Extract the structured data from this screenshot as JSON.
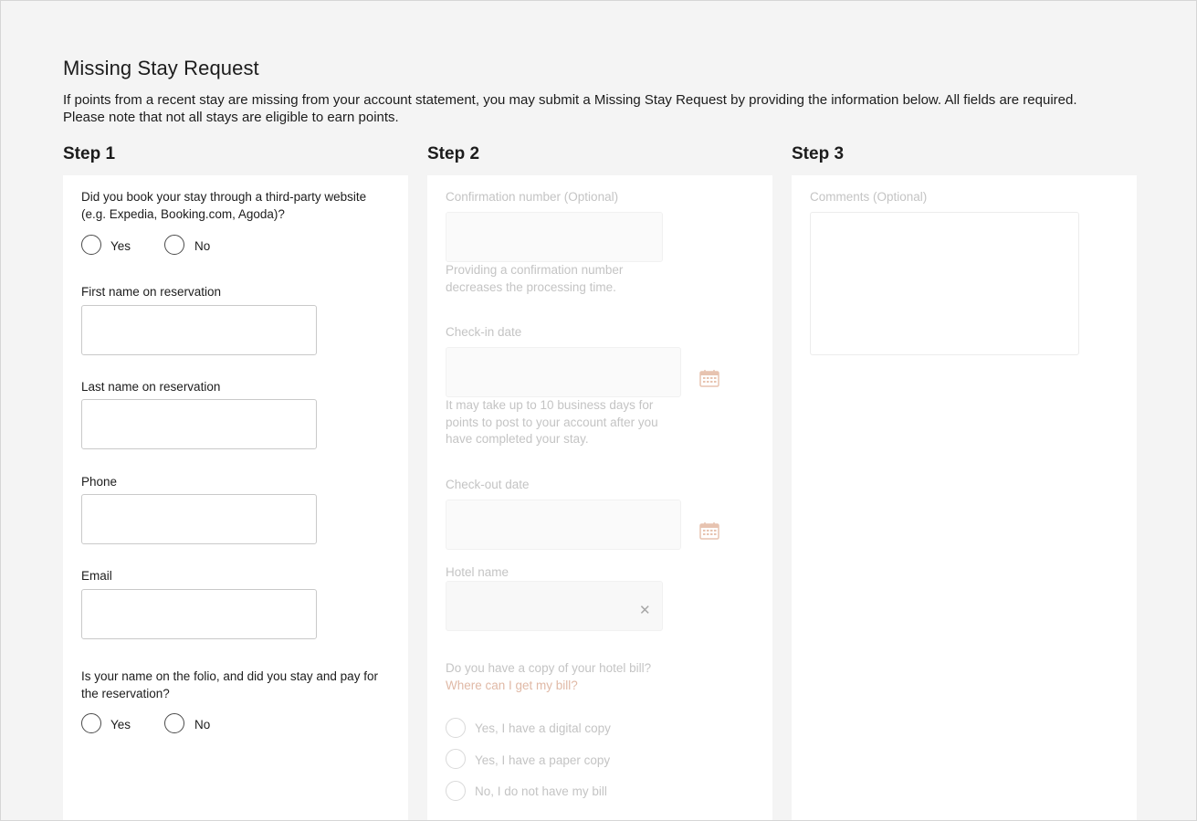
{
  "header": {
    "title": "Missing Stay Request",
    "intro_line1": "If points from a recent stay are missing from your account statement, you may submit a Missing Stay Request by providing the information below. All fields are required.",
    "intro_line2": "Please note that not all stays are eligible to earn points."
  },
  "steps": {
    "step1_title": "Step 1",
    "step2_title": "Step 2",
    "step3_title": "Step 3"
  },
  "step1": {
    "third_party_question_line1": "Did you book your stay through a third-party website",
    "third_party_question_line2": "(e.g. Expedia, Booking.com, Agoda)?",
    "yes_label": "Yes",
    "no_label": "No",
    "first_name_label": "First name on reservation",
    "first_name_value": "",
    "last_name_label": "Last name on reservation",
    "last_name_value": "",
    "phone_label": "Phone",
    "phone_value": "",
    "email_label": "Email",
    "email_value": "",
    "folio_question_line1": "Is your name on the folio, and did you stay and pay for",
    "folio_question_line2": "the reservation?",
    "folio_yes_label": "Yes",
    "folio_no_label": "No"
  },
  "step2": {
    "confirmation_label": "Confirmation number (Optional)",
    "confirmation_value": "",
    "confirmation_help_line1": "Providing a confirmation number",
    "confirmation_help_line2": "decreases the processing time.",
    "checkin_label": "Check-in date",
    "checkin_value": "",
    "checkin_help_line1": "It may take up to 10 business days for",
    "checkin_help_line2": "points to post to your account after you",
    "checkin_help_line3": "have completed your stay.",
    "checkout_label": "Check-out date",
    "checkout_value": "",
    "hotel_label": "Hotel name",
    "hotel_value": "",
    "clear_glyph": "✕",
    "bill_question": "Do you have a copy of your hotel bill?",
    "bill_link": "Where can I get my bill?",
    "bill_options": [
      "Yes, I have a digital copy",
      "Yes, I have a paper copy",
      "No, I do not have my bill"
    ]
  },
  "step3": {
    "comments_label": "Comments (Optional)",
    "comments_value": ""
  },
  "icons": {
    "calendar": "calendar-icon",
    "clear": "close-icon"
  },
  "colors": {
    "page_bg": "#f4f4f4",
    "panel_bg": "#ffffff",
    "text": "#1c1c1c",
    "disabled_text": "#c4c4c4",
    "link_disabled": "#e0b9a6",
    "calendar_accent": "#e7c3b0"
  }
}
